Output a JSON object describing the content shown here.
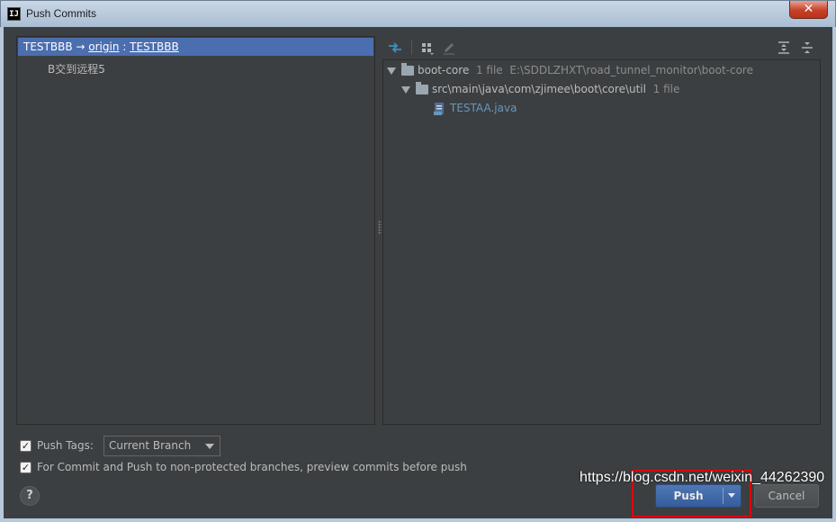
{
  "window": {
    "title": "Push Commits",
    "app_icon": "IJ",
    "close_glyph": "✕"
  },
  "left": {
    "branch_local": "TESTBBB",
    "branch_arrow": "→",
    "branch_remote": "origin",
    "branch_sep": " : ",
    "branch_target": "TESTBBB",
    "commit_message": "B交到远程5"
  },
  "toolbar": {
    "icons": [
      "diff-icon",
      "group-by-icon",
      "edit-icon",
      "expand-all-icon",
      "collapse-all-icon"
    ]
  },
  "tree": {
    "root": {
      "name": "boot-core",
      "count": "1 file",
      "path": "E:\\SDDLZHXT\\road_tunnel_monitor\\boot-core"
    },
    "folder": {
      "name": "src\\main\\java\\com\\zjimee\\boot\\core\\util",
      "count": "1 file"
    },
    "file": {
      "name": "TESTAA.java"
    }
  },
  "options": {
    "push_tags_label": "Push Tags:",
    "push_tags_checked": true,
    "push_tags_value": "Current Branch",
    "preview_label": "For Commit and Push to non-protected branches, preview commits before push",
    "preview_checked": true
  },
  "buttons": {
    "help": "?",
    "push": "Push",
    "cancel": "Cancel"
  },
  "watermark": "https://blog.csdn.net/weixin_44262390",
  "colors": {
    "background": "#3c3f41",
    "selection": "#4b6eaf",
    "file_link": "#6897bb",
    "highlight": "#e1000a",
    "push_button": "#4f78b4"
  }
}
